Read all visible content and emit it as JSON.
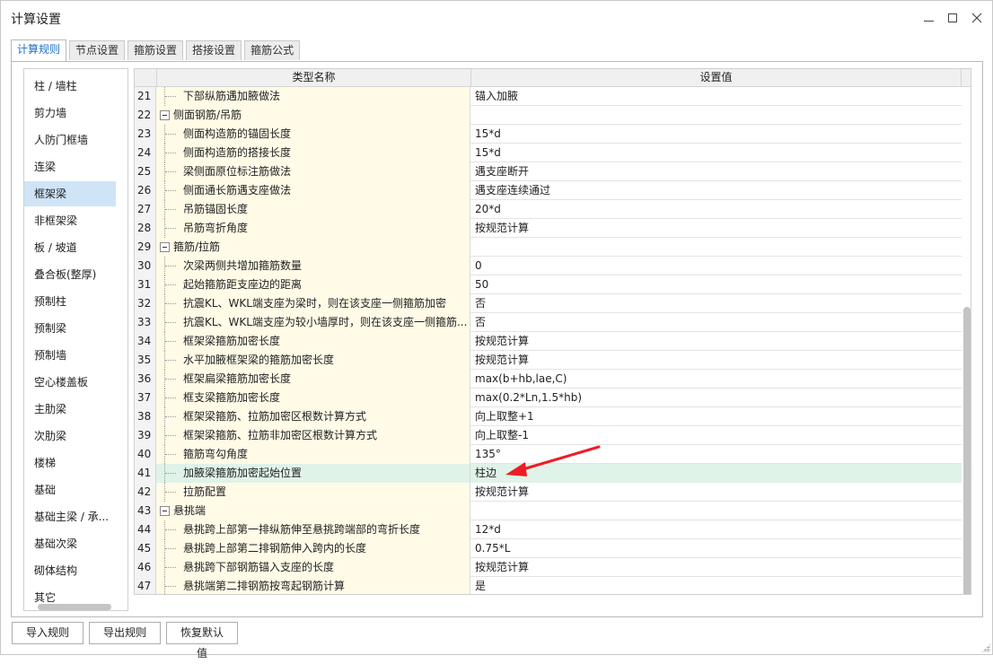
{
  "window": {
    "title": "计算设置"
  },
  "tabs": [
    {
      "label": "计算规则",
      "active": true
    },
    {
      "label": "节点设置",
      "active": false
    },
    {
      "label": "箍筋设置",
      "active": false
    },
    {
      "label": "搭接设置",
      "active": false
    },
    {
      "label": "箍筋公式",
      "active": false
    }
  ],
  "sidebar": {
    "selected_index": 4,
    "items": [
      {
        "label": "柱 / 墙柱"
      },
      {
        "label": "剪力墙"
      },
      {
        "label": "人防门框墙"
      },
      {
        "label": "连梁"
      },
      {
        "label": "框架梁"
      },
      {
        "label": "非框架梁"
      },
      {
        "label": "板 / 坡道"
      },
      {
        "label": "叠合板(整厚)"
      },
      {
        "label": "预制柱"
      },
      {
        "label": "预制梁"
      },
      {
        "label": "预制墙"
      },
      {
        "label": "空心楼盖板"
      },
      {
        "label": "主肋梁"
      },
      {
        "label": "次肋梁"
      },
      {
        "label": "楼梯"
      },
      {
        "label": "基础"
      },
      {
        "label": "基础主梁 / 承..."
      },
      {
        "label": "基础次梁"
      },
      {
        "label": "砌体结构"
      },
      {
        "label": "其它"
      }
    ]
  },
  "table": {
    "headers": {
      "name": "类型名称",
      "value": "设置值"
    },
    "highlight_row": 41,
    "rows": [
      {
        "num": "21",
        "name": "下部纵筋遇加腋做法",
        "value": "锚入加腋",
        "group": false
      },
      {
        "num": "22",
        "name": "侧面钢筋/吊筋",
        "value": "",
        "group": true
      },
      {
        "num": "23",
        "name": "侧面构造筋的锚固长度",
        "value": "15*d",
        "group": false
      },
      {
        "num": "24",
        "name": "侧面构造筋的搭接长度",
        "value": "15*d",
        "group": false
      },
      {
        "num": "25",
        "name": "梁侧面原位标注筋做法",
        "value": "遇支座断开",
        "group": false
      },
      {
        "num": "26",
        "name": "侧面通长筋遇支座做法",
        "value": "遇支座连续通过",
        "group": false
      },
      {
        "num": "27",
        "name": "吊筋锚固长度",
        "value": "20*d",
        "group": false
      },
      {
        "num": "28",
        "name": "吊筋弯折角度",
        "value": "按规范计算",
        "group": false
      },
      {
        "num": "29",
        "name": "箍筋/拉筋",
        "value": "",
        "group": true
      },
      {
        "num": "30",
        "name": "次梁两侧共增加箍筋数量",
        "value": "0",
        "group": false
      },
      {
        "num": "31",
        "name": "起始箍筋距支座边的距离",
        "value": "50",
        "group": false
      },
      {
        "num": "32",
        "name": "抗震KL、WKL端支座为梁时，则在该支座一侧箍筋加密",
        "value": "否",
        "group": false
      },
      {
        "num": "33",
        "name": "抗震KL、WKL端支座为较小墙厚时，则在该支座一侧箍筋...",
        "value": "否",
        "group": false
      },
      {
        "num": "34",
        "name": "框架梁箍筋加密长度",
        "value": "按规范计算",
        "group": false
      },
      {
        "num": "35",
        "name": "水平加腋框架梁的箍筋加密长度",
        "value": "按规范计算",
        "group": false
      },
      {
        "num": "36",
        "name": "框架扁梁箍筋加密长度",
        "value": "max(b+hb,lae,C)",
        "group": false
      },
      {
        "num": "37",
        "name": "框支梁箍筋加密长度",
        "value": "max(0.2*Ln,1.5*hb)",
        "group": false
      },
      {
        "num": "38",
        "name": "框架梁箍筋、拉筋加密区根数计算方式",
        "value": "向上取整+1",
        "group": false
      },
      {
        "num": "39",
        "name": "框架梁箍筋、拉筋非加密区根数计算方式",
        "value": "向上取整-1",
        "group": false
      },
      {
        "num": "40",
        "name": "箍筋弯勾角度",
        "value": "135°",
        "group": false
      },
      {
        "num": "41",
        "name": "加腋梁箍筋加密起始位置",
        "value": "柱边",
        "group": false
      },
      {
        "num": "42",
        "name": "拉筋配置",
        "value": "按规范计算",
        "group": false
      },
      {
        "num": "43",
        "name": "悬挑端",
        "value": "",
        "group": true
      },
      {
        "num": "44",
        "name": "悬挑跨上部第一排纵筋伸至悬挑跨端部的弯折长度",
        "value": "12*d",
        "group": false
      },
      {
        "num": "45",
        "name": "悬挑跨上部第二排钢筋伸入跨内的长度",
        "value": "0.75*L",
        "group": false
      },
      {
        "num": "46",
        "name": "悬挑跨下部钢筋锚入支座的长度",
        "value": "按规范计算",
        "group": false
      },
      {
        "num": "47",
        "name": "悬挑端第二排钢筋按弯起钢筋计算",
        "value": "是",
        "group": false
      }
    ]
  },
  "buttons": {
    "import": "导入规则",
    "export": "导出规则",
    "restore": "恢复默认值"
  },
  "colors": {
    "tab_active_text": "#1c6fc4",
    "sidebar_selected": "#cfe4f7",
    "name_cell_bg": "#fffbe7",
    "highlight_row_bg": "#dff3e8",
    "annotation_arrow": "#ee1c25"
  },
  "icons": {
    "minimize": "minimize-icon",
    "maximize": "maximize-icon",
    "close": "close-icon",
    "expander": "collapse-minus-icon",
    "annotation": "red-arrow-icon"
  }
}
